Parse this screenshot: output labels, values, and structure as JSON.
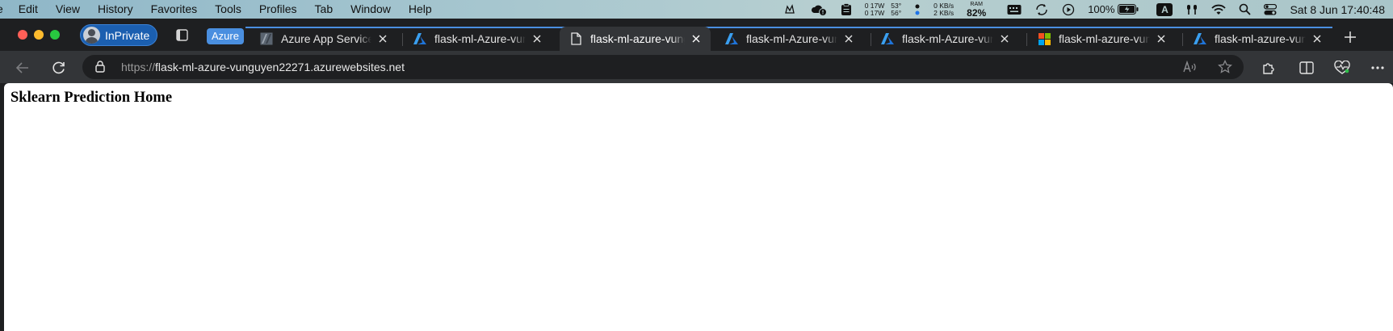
{
  "menubar": {
    "app_fragment": "e",
    "items": [
      "Edit",
      "View",
      "History",
      "Favorites",
      "Tools",
      "Profiles",
      "Tab",
      "Window",
      "Help"
    ],
    "status": {
      "power_line1": "0  17W",
      "power_line2": "0  17W",
      "temp_line1": "53°",
      "temp_line2": "56°",
      "net_up": "0 KB/s",
      "net_down": "2 KB/s",
      "ram_label": "RAM",
      "ram_value": "82%",
      "battery": "100%",
      "input_source": "A",
      "clock": "Sat 8 Jun  17:40:48"
    }
  },
  "browser": {
    "profile_label": "InPrivate",
    "tab_group_label": "Azure",
    "tabs": [
      {
        "title": "Azure App Service",
        "icon": "app-service-icon",
        "active": false
      },
      {
        "title": "flask-ml-Azure-vunguyen",
        "icon": "azure-icon",
        "active": false
      },
      {
        "title": "flask-ml-azure-vunguyen",
        "icon": "page-icon",
        "active": true
      },
      {
        "title": "flask-ml-Azure-vunguyen",
        "icon": "azure-icon",
        "active": false
      },
      {
        "title": "flask-ml-Azure-vunguyen",
        "icon": "azure-icon",
        "active": false
      },
      {
        "title": "flask-ml-azure-vunguyen",
        "icon": "microsoft-icon",
        "active": false
      },
      {
        "title": "flask-ml-azure-vunguyen",
        "icon": "azure-icon",
        "active": false
      }
    ],
    "address": {
      "scheme": "https://",
      "host": "flask-ml-azure-vunguyen22271.azurewebsites.net"
    },
    "colors": {
      "group_accent": "#4a8fe0",
      "profile_badge": "#1b5fb0"
    }
  },
  "page": {
    "heading": "Sklearn Prediction Home"
  }
}
